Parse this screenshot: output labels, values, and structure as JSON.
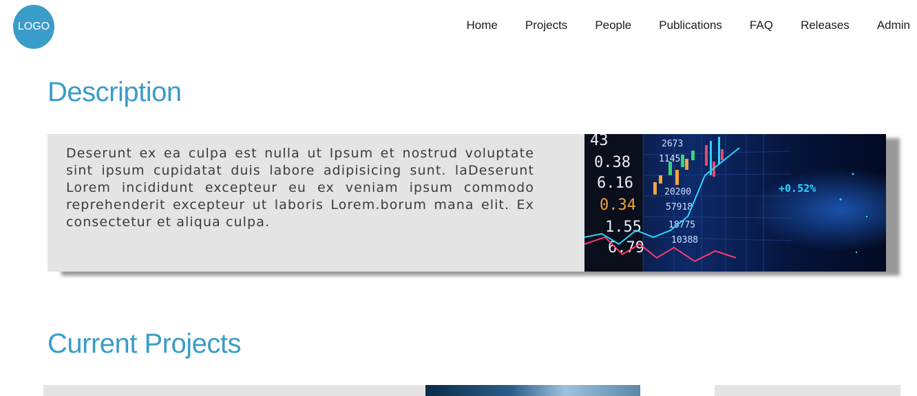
{
  "logo": {
    "text": "LOGO"
  },
  "nav": {
    "items": [
      "Home",
      "Projects",
      "People",
      "Publications",
      "FAQ",
      "Releases",
      "Admin"
    ]
  },
  "description": {
    "title": "Description",
    "text": "Deserunt ex ea culpa est nulla ut Ipsum et nostrud voluptate sint ipsum cupidatat duis labore adipisicing sunt. laDeserunt Lorem incididunt excepteur eu ex veniam ipsum commodo reprehenderit excepteur ut laboris Lorem.borum mana elit. Ex consectetur et aliqua culpa.",
    "image": {
      "numbers_left": [
        "43",
        "0.38",
        "6.16",
        "0.34",
        "1.55",
        "6.79"
      ],
      "numbers_mid": [
        "2673",
        "1145",
        "20200",
        "57918",
        "18775",
        "10388"
      ],
      "percent": "+0.52%"
    }
  },
  "projects": {
    "title": "Current Projects"
  },
  "colors": {
    "accent": "#3a9cc8",
    "card_bg": "#e4e4e4"
  }
}
